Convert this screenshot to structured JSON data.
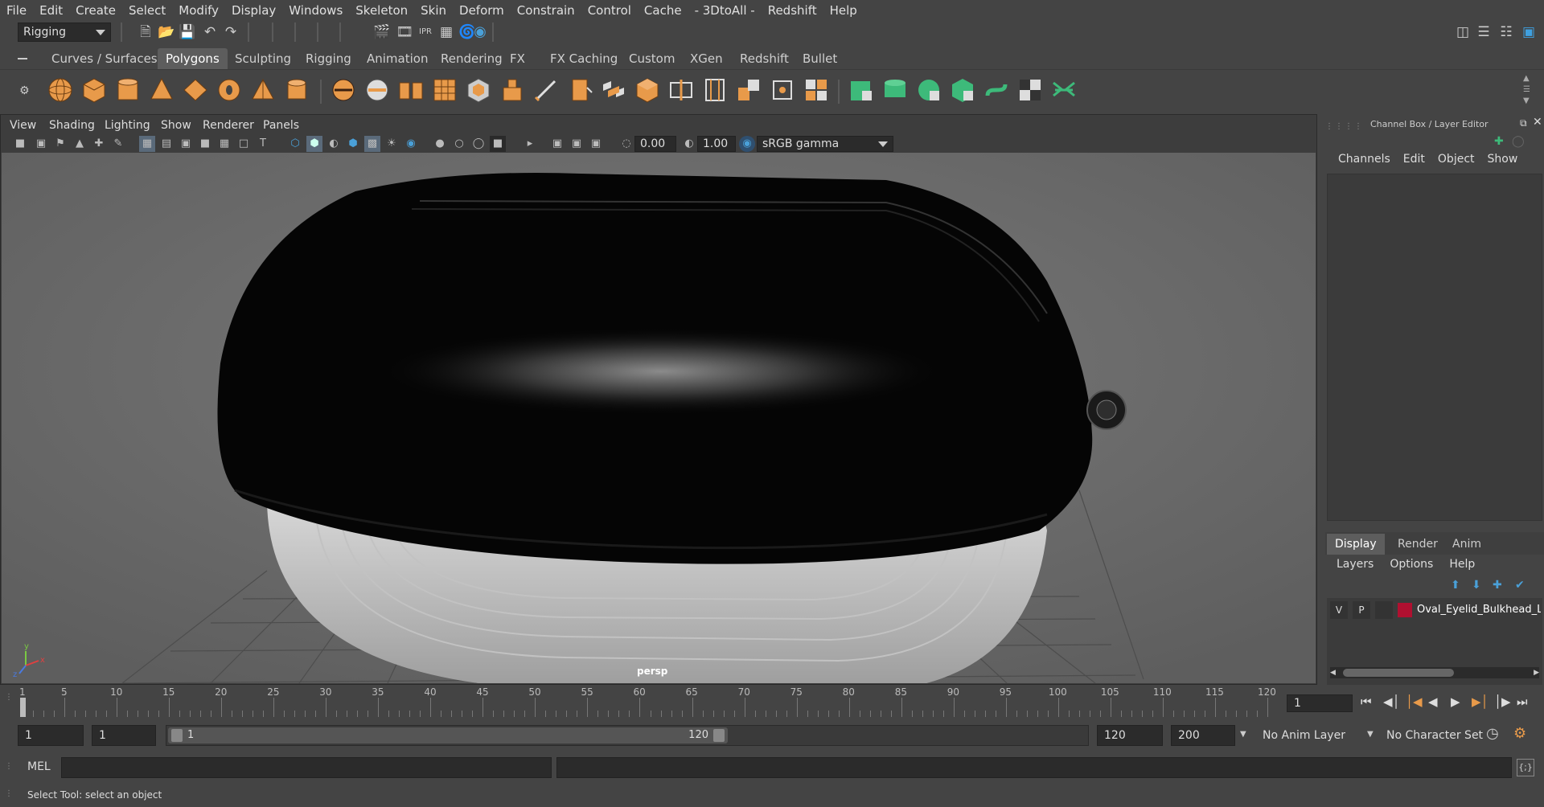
{
  "menubar": {
    "items": [
      "File",
      "Edit",
      "Create",
      "Select",
      "Modify",
      "Display",
      "Windows",
      "Skeleton",
      "Skin",
      "Deform",
      "Constrain",
      "Control",
      "Cache",
      "- 3DtoAll -",
      "Redshift",
      "Help"
    ]
  },
  "status_line": {
    "menu_set": "Rigging"
  },
  "shelf": {
    "tabs": [
      "Curves / Surfaces",
      "Polygons",
      "Sculpting",
      "Rigging",
      "Animation",
      "Rendering",
      "FX",
      "FX Caching",
      "Custom",
      "XGen",
      "Redshift",
      "Bullet"
    ],
    "active_tab": "Polygons"
  },
  "viewport": {
    "menu": [
      "View",
      "Shading",
      "Lighting",
      "Show",
      "Renderer",
      "Panels"
    ],
    "exposure": "0.00",
    "gamma": "1.00",
    "color_space": "sRGB gamma",
    "camera_label": "persp"
  },
  "channel_box": {
    "title": "Channel Box / Layer Editor",
    "menu": [
      "Channels",
      "Edit",
      "Object",
      "Show"
    ]
  },
  "layer_editor": {
    "tabs": [
      "Display",
      "Render",
      "Anim"
    ],
    "active_tab": "Display",
    "menu": [
      "Layers",
      "Options",
      "Help"
    ],
    "layers": [
      {
        "v": "V",
        "p": "P",
        "color": "#b01030",
        "name": "Oval_Eyelid_Bulkhead_Li"
      }
    ]
  },
  "timeline": {
    "ticks": [
      "1",
      "5",
      "10",
      "15",
      "20",
      "25",
      "30",
      "35",
      "40",
      "45",
      "50",
      "55",
      "60",
      "65",
      "70",
      "75",
      "80",
      "85",
      "90",
      "95",
      "100",
      "105",
      "110",
      "115",
      "120"
    ],
    "current_frame": "1"
  },
  "range": {
    "start": "1",
    "anim_start": "1",
    "slider_start": "1",
    "slider_end": "120",
    "end": "120",
    "anim_end": "200",
    "anim_layer": "No Anim Layer",
    "char_set": "No Character Set"
  },
  "command_line": {
    "lang": "MEL"
  },
  "help_line": {
    "text": "Select Tool: select an object"
  }
}
